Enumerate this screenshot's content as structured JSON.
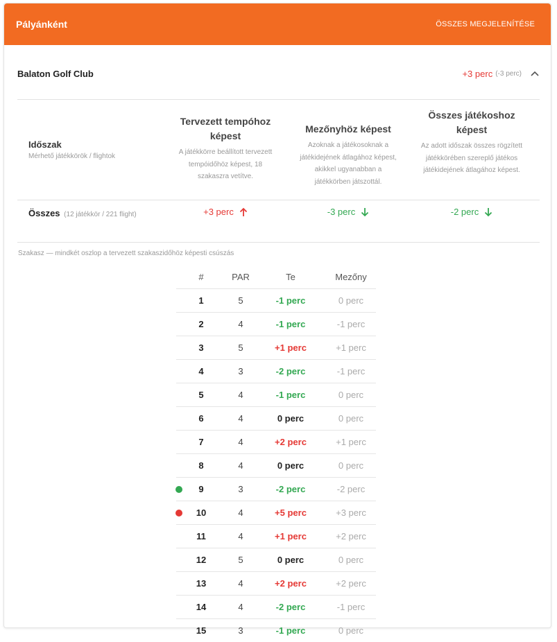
{
  "header": {
    "title": "Pályánként",
    "show_all": "ÖSSZES MEGJELENÍTÉSE"
  },
  "club": {
    "name": "Balaton Golf Club",
    "delta": "+3 perc",
    "delta_sub": "(-3 perc)"
  },
  "columns": [
    {
      "title": "Tervezett tempóhoz képest",
      "desc": "A játékkörre beállított tervezett tempóidőhöz képest, 18 szakaszra vetítve."
    },
    {
      "title": "Mezőnyhöz képest",
      "desc": "Azoknak a játékosoknak a játékidejének átlagához képest, akikkel ugyanabban a játékkörben játszottál."
    },
    {
      "title": "Összes játékoshoz képest",
      "desc": "Az adott időszak összes rögzített játékkörében szereplő játékos játékidejének átlagához képest."
    }
  ],
  "period": {
    "title": "Időszak",
    "subtitle": "Mérhető játékkörök / flightok"
  },
  "total": {
    "label": "Összes",
    "sub": "(12 játékkör / 221 flight)",
    "values": [
      {
        "text": "+3 perc",
        "dir": "up",
        "color": "#e53935"
      },
      {
        "text": "-3 perc",
        "dir": "down",
        "color": "#33a852"
      },
      {
        "text": "-2 perc",
        "dir": "down",
        "color": "#33a852"
      }
    ]
  },
  "note": "Szakasz  — mindkét oszlop a tervezett szakaszidőhöz képesti csúszás",
  "table": {
    "headers": [
      "#",
      "PAR",
      "Te",
      "Mezőny"
    ],
    "rows": [
      {
        "num": "1",
        "par": "5",
        "te": "-1 perc",
        "te_color": "green",
        "mz": "0 perc",
        "marker": ""
      },
      {
        "num": "2",
        "par": "4",
        "te": "-1 perc",
        "te_color": "green",
        "mz": "-1 perc",
        "marker": ""
      },
      {
        "num": "3",
        "par": "5",
        "te": "+1 perc",
        "te_color": "red",
        "mz": "+1 perc",
        "marker": ""
      },
      {
        "num": "4",
        "par": "3",
        "te": "-2 perc",
        "te_color": "green",
        "mz": "-1 perc",
        "marker": ""
      },
      {
        "num": "5",
        "par": "4",
        "te": "-1 perc",
        "te_color": "green",
        "mz": "0 perc",
        "marker": ""
      },
      {
        "num": "6",
        "par": "4",
        "te": "0 perc",
        "te_color": "black",
        "mz": "0 perc",
        "marker": ""
      },
      {
        "num": "7",
        "par": "4",
        "te": "+2 perc",
        "te_color": "red",
        "mz": "+1 perc",
        "marker": ""
      },
      {
        "num": "8",
        "par": "4",
        "te": "0 perc",
        "te_color": "black",
        "mz": "0 perc",
        "marker": ""
      },
      {
        "num": "9",
        "par": "3",
        "te": "-2 perc",
        "te_color": "green",
        "mz": "-2 perc",
        "marker": "#33a852"
      },
      {
        "num": "10",
        "par": "4",
        "te": "+5 perc",
        "te_color": "red",
        "mz": "+3 perc",
        "marker": "#e53935"
      },
      {
        "num": "11",
        "par": "4",
        "te": "+1 perc",
        "te_color": "red",
        "mz": "+2 perc",
        "marker": ""
      },
      {
        "num": "12",
        "par": "5",
        "te": "0 perc",
        "te_color": "black",
        "mz": "0 perc",
        "marker": ""
      },
      {
        "num": "13",
        "par": "4",
        "te": "+2 perc",
        "te_color": "red",
        "mz": "+2 perc",
        "marker": ""
      },
      {
        "num": "14",
        "par": "4",
        "te": "-2 perc",
        "te_color": "green",
        "mz": "-1 perc",
        "marker": ""
      },
      {
        "num": "15",
        "par": "3",
        "te": "-1 perc",
        "te_color": "green",
        "mz": "0 perc",
        "marker": ""
      }
    ]
  }
}
